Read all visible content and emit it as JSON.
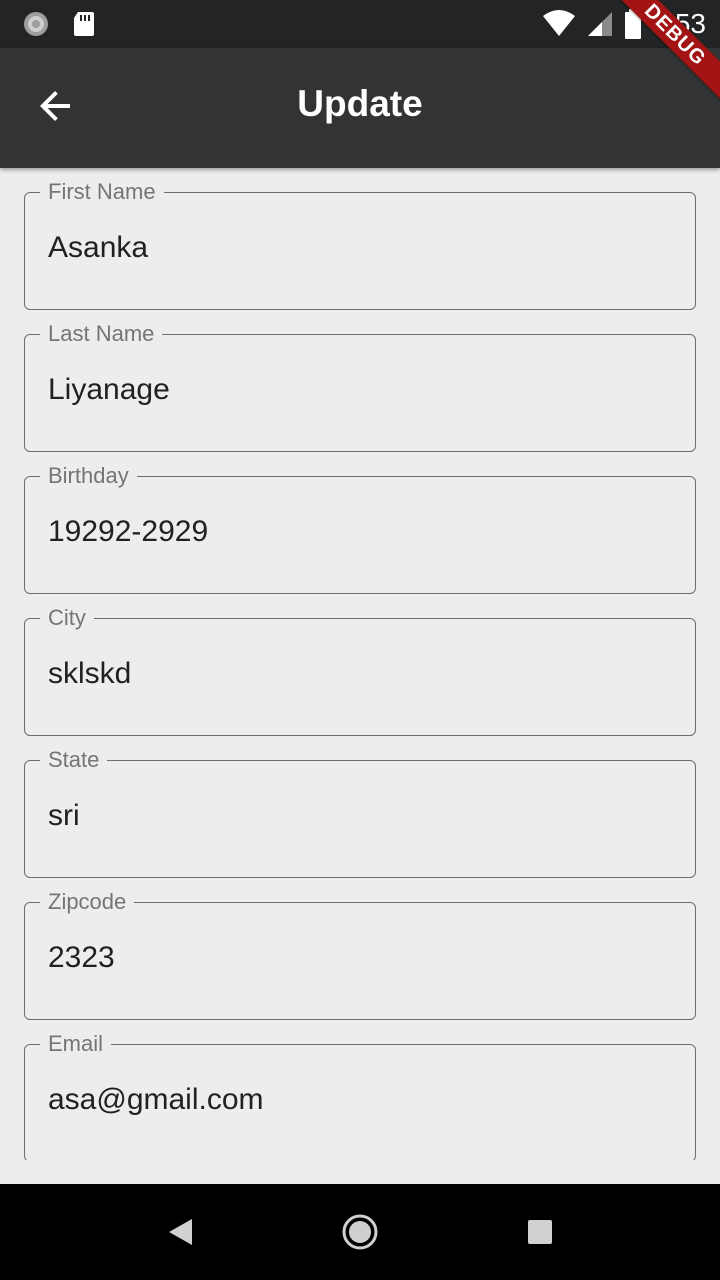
{
  "status_bar": {
    "time": "6:53",
    "icons": [
      "sync-icon",
      "sd-card-icon",
      "wifi-icon",
      "signal-icon",
      "battery-icon"
    ]
  },
  "debug_banner": "DEBUG",
  "app_bar": {
    "title": "Update",
    "back_icon": "arrow-back-icon"
  },
  "form": {
    "fields": [
      {
        "label": "First Name",
        "value": "Asanka"
      },
      {
        "label": "Last Name",
        "value": "Liyanage"
      },
      {
        "label": "Birthday",
        "value": "19292-2929"
      },
      {
        "label": "City",
        "value": "sklskd"
      },
      {
        "label": "State",
        "value": "sri"
      },
      {
        "label": "Zipcode",
        "value": "2323"
      },
      {
        "label": "Email",
        "value": "asa@gmail.com"
      }
    ]
  },
  "nav_bar": {
    "icons": [
      "back-triangle-icon",
      "home-circle-icon",
      "recents-square-icon"
    ]
  },
  "colors": {
    "status_bar": "#242424",
    "app_bar": "#333333",
    "background": "#ededed",
    "debug": "#a31515"
  }
}
